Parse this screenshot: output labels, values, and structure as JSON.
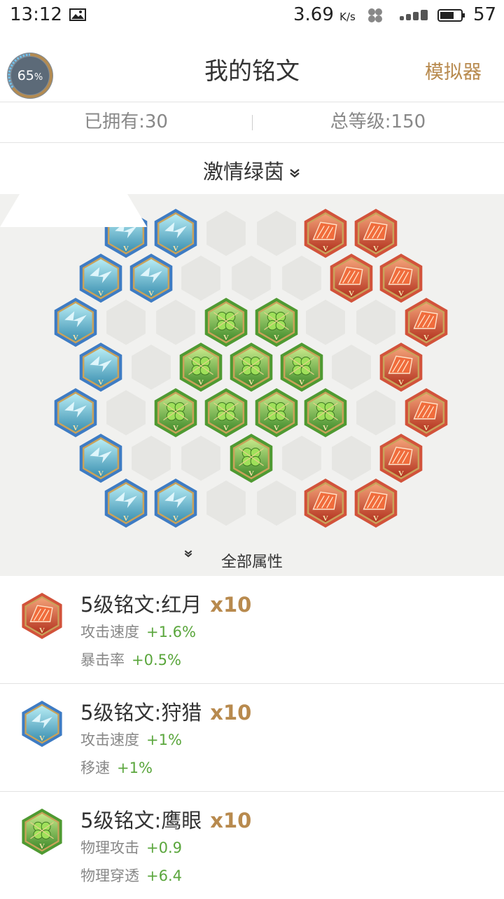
{
  "status_bar": {
    "time": "13:12",
    "net_speed": "3.69",
    "net_speed_unit": "K/s",
    "battery": "57",
    "icons": [
      "image-icon",
      "clover-icon",
      "signal-icon",
      "battery-icon"
    ]
  },
  "header": {
    "progress_value": "65",
    "progress_unit": "%",
    "progress_fraction": 0.65,
    "title": "我的铭文",
    "simulator_label": "模拟器"
  },
  "stats": {
    "owned": "已拥有:30",
    "total_level": "总等级:150"
  },
  "page_selector": {
    "name": "激情绿茵"
  },
  "board": {
    "all_props_label": "全部属性",
    "slots": {
      "blue": 10,
      "green": 10,
      "red": 10
    }
  },
  "inscriptions": [
    {
      "title": "5级铭文:红月",
      "count": "x10",
      "color": "red",
      "attrs": [
        {
          "name": "攻击速度",
          "value": "+1.6%"
        },
        {
          "name": "暴击率",
          "value": "+0.5%"
        }
      ]
    },
    {
      "title": "5级铭文:狩猎",
      "count": "x10",
      "color": "blue",
      "attrs": [
        {
          "name": "攻击速度",
          "value": "+1%"
        },
        {
          "name": "移速",
          "value": "+1%"
        }
      ]
    },
    {
      "title": "5级铭文:鹰眼",
      "count": "x10",
      "color": "green",
      "attrs": [
        {
          "name": "物理攻击",
          "value": "+0.9"
        },
        {
          "name": "物理穿透",
          "value": "+6.4"
        }
      ]
    }
  ],
  "colors": {
    "accent": "#b88a4e",
    "positive": "#5aa63c",
    "blue_gem": "#3e7cc4",
    "green_gem": "#4f9a32",
    "red_gem": "#d2533b"
  }
}
